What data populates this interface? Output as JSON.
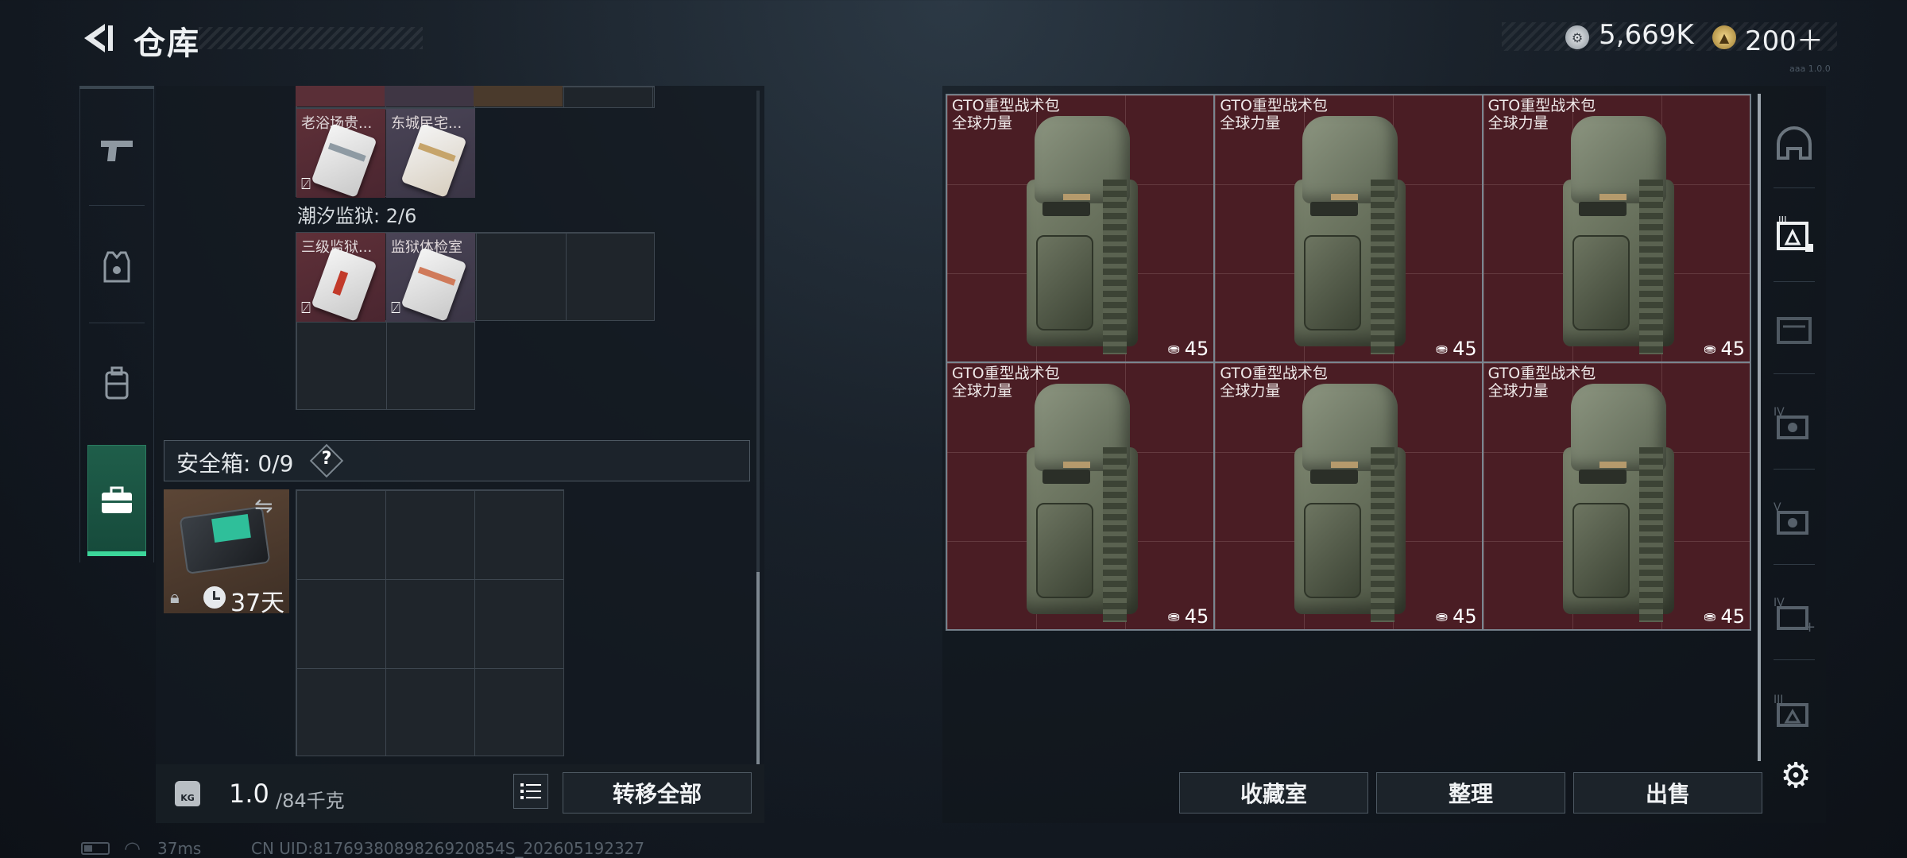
{
  "header": {
    "title": "仓库",
    "currency_silver": "5,669K",
    "currency_gold": "200＋",
    "version_text": "aaa 1.0.0"
  },
  "left_rail": {
    "items": [
      {
        "icon": "pistol-icon"
      },
      {
        "icon": "armor-vest-icon"
      },
      {
        "icon": "backpack-icon"
      },
      {
        "icon": "toolbox-icon"
      }
    ],
    "active_index": 3
  },
  "storage": {
    "cards_top": [
      {
        "name": "老浴场贵...",
        "color": "red"
      },
      {
        "name": "东城民宅...",
        "color": "purple"
      }
    ],
    "prison_label": "潮汐监狱: 2/6",
    "cards_prison": [
      {
        "name": "三级监狱...",
        "color": "red"
      },
      {
        "name": "监狱体检室",
        "color": "purple"
      }
    ]
  },
  "safe": {
    "label": "安全箱: 0/9",
    "help": "?",
    "days_left": "37天"
  },
  "bottom_left": {
    "weight_current": "1.0",
    "weight_max": "/84千克",
    "kg_badge": "KG",
    "transfer_all": "转移全部"
  },
  "inventory": {
    "items": [
      {
        "name": "GTO重型战术包",
        "sub": "全球力量",
        "capacity": "45"
      },
      {
        "name": "GTO重型战术包",
        "sub": "全球力量",
        "capacity": "45"
      },
      {
        "name": "GTO重型战术包",
        "sub": "全球力量",
        "capacity": "45"
      },
      {
        "name": "GTO重型战术包",
        "sub": "全球力量",
        "capacity": "45"
      },
      {
        "name": "GTO重型战术包",
        "sub": "全球力量",
        "capacity": "45"
      },
      {
        "name": "GTO重型战术包",
        "sub": "全球力量",
        "capacity": "45"
      }
    ]
  },
  "right_rail": {
    "labels": [
      "",
      "",
      "",
      "IV",
      "V",
      "IV",
      "III"
    ]
  },
  "bottom_right": {
    "collection": "收藏室",
    "sort": "整理",
    "sell": "出售"
  },
  "footer": {
    "ping": "37ms",
    "uid": "CN UID:8176938089826920854S_202605192327"
  },
  "colors": {
    "item_rarity_red": "#4a1d24",
    "accent_green": "#3cd69a"
  }
}
